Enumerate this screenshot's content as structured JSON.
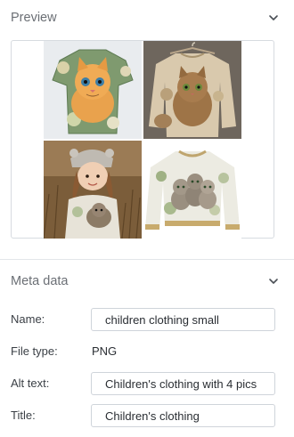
{
  "preview": {
    "title": "Preview",
    "toggle_icon": "chevron-down-icon",
    "images": [
      {
        "label": "cat t-shirt"
      },
      {
        "label": "cat sweater"
      },
      {
        "label": "child in cat sweater"
      },
      {
        "label": "cats sweatshirt"
      }
    ]
  },
  "meta": {
    "title": "Meta data",
    "toggle_icon": "chevron-down-icon",
    "name_label": "Name:",
    "name_value": "children clothing small",
    "file_type_label": "File type:",
    "file_type_value": "PNG",
    "alt_text_label": "Alt text:",
    "alt_text_value": "Children's clothing with 4 pics",
    "title_label": "Title:",
    "title_value": "Children's clothing"
  }
}
